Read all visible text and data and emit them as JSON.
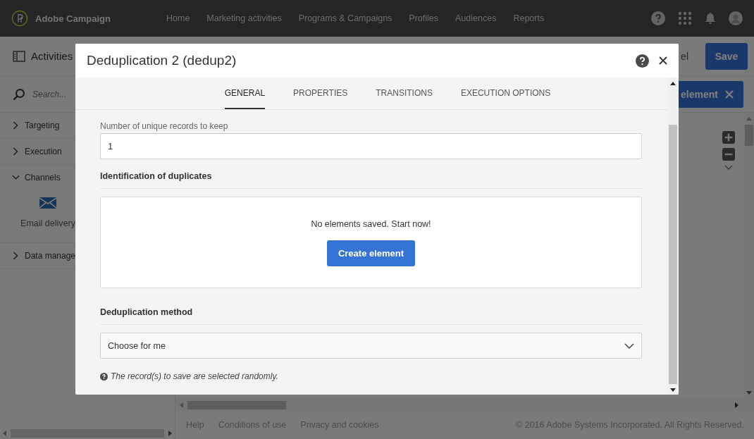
{
  "header": {
    "brand": "Adobe Campaign",
    "nav": [
      "Home",
      "Marketing activities",
      "Programs & Campaigns",
      "Profiles",
      "Audiences",
      "Reports"
    ]
  },
  "toolbar": {
    "title": "Activities",
    "cancel": "el",
    "save": "Save"
  },
  "sidebar": {
    "search_placeholder": "Search...",
    "groups": [
      {
        "label": "Targeting",
        "expanded": false
      },
      {
        "label": "Execution",
        "expanded": false
      },
      {
        "label": "Channels",
        "expanded": true,
        "items": [
          {
            "label": "Email delivery"
          }
        ]
      },
      {
        "label": "Data manage",
        "expanded": false
      }
    ]
  },
  "canvas": {
    "chip": "element"
  },
  "footer": {
    "links": [
      "Help",
      "Conditions of use",
      "Privacy and cookies"
    ],
    "copyright": "© 2016 Adobe Systems Incorporated. All Rights Reserved."
  },
  "dialog": {
    "title": "Deduplication 2 (dedup2)",
    "tabs": [
      {
        "label": "GENERAL",
        "selected": true
      },
      {
        "label": "PROPERTIES",
        "selected": false
      },
      {
        "label": "TRANSITIONS",
        "selected": false
      },
      {
        "label": "EXECUTION OPTIONS",
        "selected": false
      }
    ],
    "records_label": "Number of unique records to keep",
    "records_value": "1",
    "identification_title": "Identification of duplicates",
    "empty_text": "No elements saved. Start now!",
    "create_button": "Create element",
    "method_title": "Deduplication method",
    "method_value": "Choose for me",
    "hint": "The record(s) to save are selected randomly."
  }
}
